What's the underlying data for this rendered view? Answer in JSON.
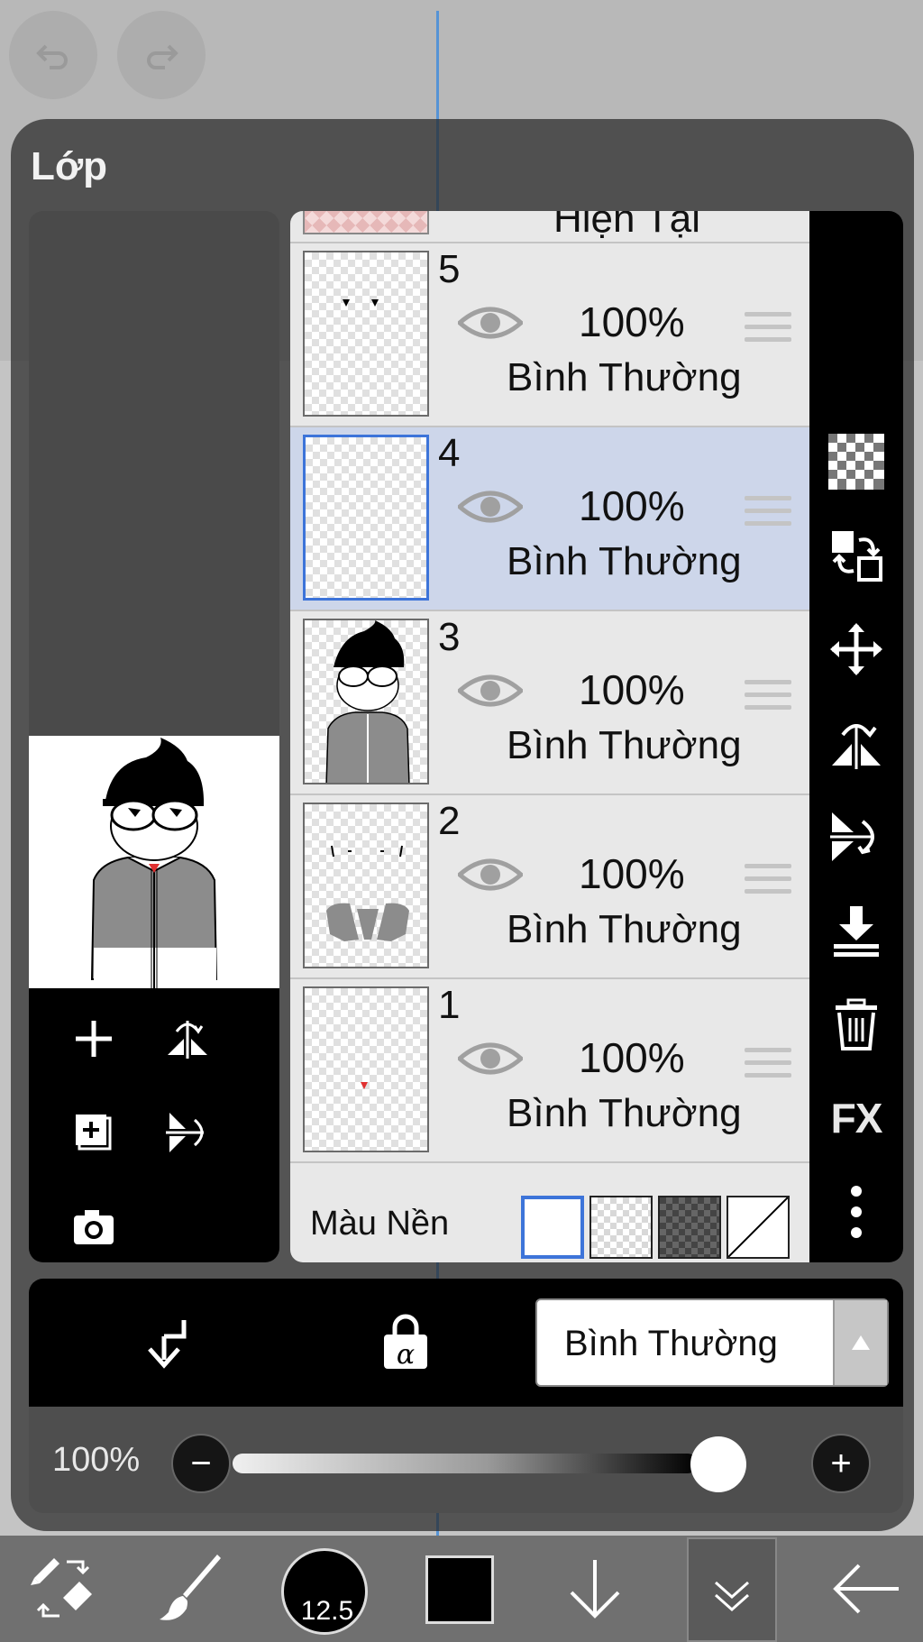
{
  "panel": {
    "title": "Lớp"
  },
  "layers": {
    "partial_label": "Hiện Tại",
    "items": [
      {
        "number": "5",
        "opacity": "100%",
        "blend": "Bình Thường",
        "selected": false
      },
      {
        "number": "4",
        "opacity": "100%",
        "blend": "Bình Thường",
        "selected": true
      },
      {
        "number": "3",
        "opacity": "100%",
        "blend": "Bình Thường",
        "selected": false
      },
      {
        "number": "2",
        "opacity": "100%",
        "blend": "Bình Thường",
        "selected": false
      },
      {
        "number": "1",
        "opacity": "100%",
        "blend": "Bình Thường",
        "selected": false
      }
    ]
  },
  "background": {
    "label": "Màu Nền",
    "selected": "white"
  },
  "side_tools": {
    "fx_label": "FX"
  },
  "blend_mode": {
    "selected": "Bình Thường"
  },
  "opacity_control": {
    "label": "100%",
    "value_fraction": 1.0,
    "minus": "−",
    "plus": "+"
  },
  "toolbar": {
    "brush_size": "12.5",
    "current_color": "#000000"
  },
  "colors": {
    "accent": "#3d74d9",
    "selected_row": "#cdd6ea",
    "guide_line": "#4a8fd8",
    "heart_red": "#e03030"
  }
}
